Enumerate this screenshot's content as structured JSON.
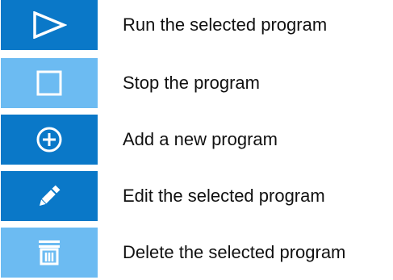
{
  "colors": {
    "primary_button": "#0a78c8",
    "secondary_button": "#6cbbf2",
    "icon": "#ffffff",
    "text": "#111111",
    "background": "#ffffff"
  },
  "actions": [
    {
      "icon": "play-icon",
      "state": "active",
      "label": "Run the selected program"
    },
    {
      "icon": "stop-icon",
      "state": "disabled",
      "label": "Stop the program"
    },
    {
      "icon": "add-circle-icon",
      "state": "active",
      "label": "Add a new program"
    },
    {
      "icon": "pencil-icon",
      "state": "active",
      "label": "Edit the selected program"
    },
    {
      "icon": "trash-icon",
      "state": "disabled",
      "label": "Delete the selected program"
    }
  ]
}
